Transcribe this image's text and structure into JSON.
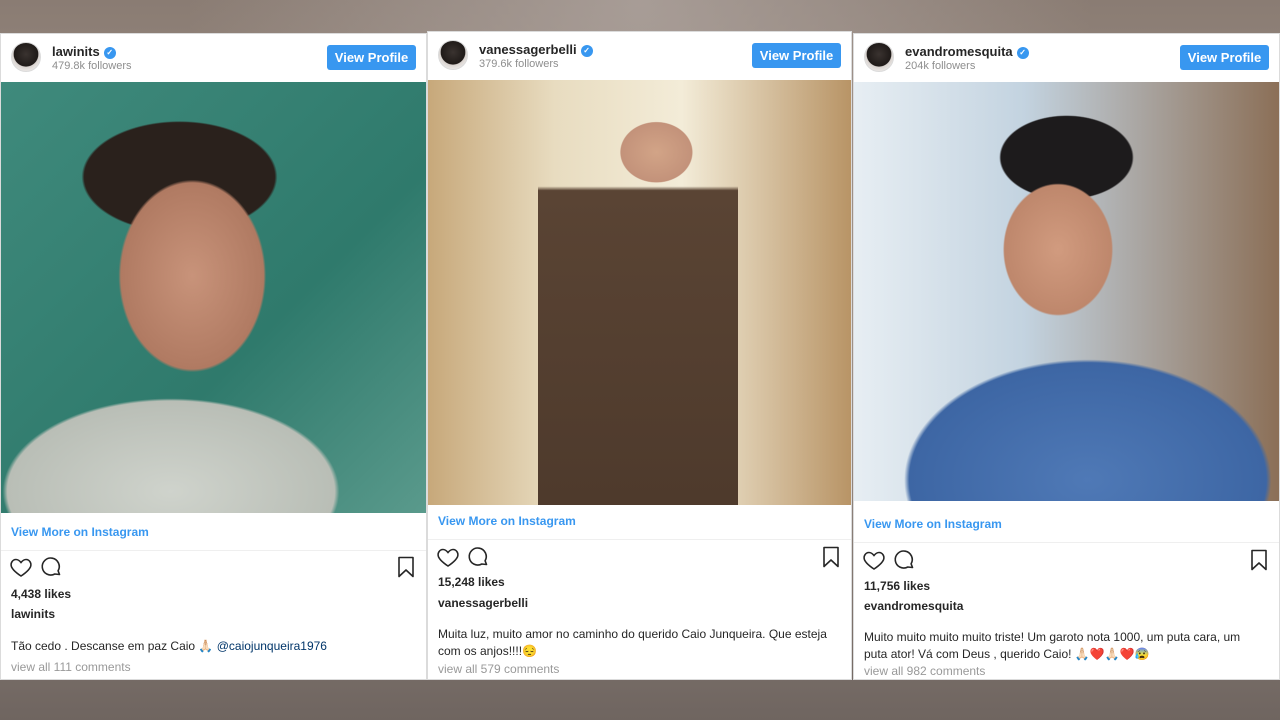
{
  "posts": [
    {
      "username": "lawinits",
      "followers": "479.8k followers",
      "view_profile": "View Profile",
      "view_more": "View More on Instagram",
      "likes": "4,438 likes",
      "caption_author": "lawinits",
      "caption_text": "Tão cedo . Descanse em paz Caio 🙏🏻",
      "caption_mention": "@caiojunqueira1976",
      "comments": "view all 111 comments"
    },
    {
      "username": "vanessagerbelli",
      "followers": "379.6k followers",
      "view_profile": "View Profile",
      "view_more": "View More on Instagram",
      "likes": "15,248 likes",
      "caption_author": "vanessagerbelli",
      "caption_text": "Muita luz, muito amor no caminho do querido Caio Junqueira. Que esteja com os anjos!!!!😔",
      "comments": "view all 579 comments"
    },
    {
      "username": "evandromesquita",
      "followers": "204k followers",
      "view_profile": "View Profile",
      "view_more": "View More on Instagram",
      "likes": "11,756 likes",
      "caption_author": "evandromesquita",
      "caption_text": "Muito muito muito muito triste! Um garoto nota 1000, um puta cara, um puta ator! Vá com Deus , querido Caio! 🙏🏻❤️🙏🏻❤️😰",
      "comments": "view all 982 comments"
    }
  ],
  "icons": {
    "verified": "verified-badge-icon",
    "heart": "heart-icon",
    "comment": "comment-icon",
    "save": "bookmark-icon"
  },
  "colors": {
    "accent": "#3897f0",
    "text": "#262626",
    "muted": "#999999"
  }
}
